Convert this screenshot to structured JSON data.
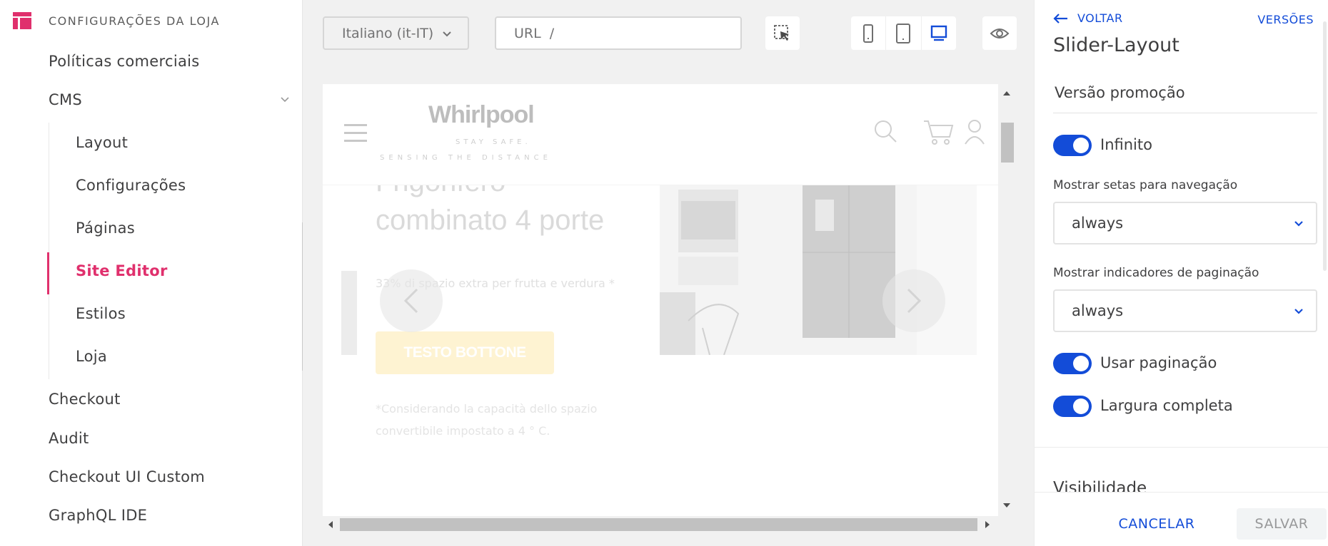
{
  "sidebar": {
    "title": "CONFIGURAÇÕES DA LOJA",
    "items": [
      {
        "label": "Políticas comerciais"
      },
      {
        "label": "CMS"
      },
      {
        "label": "Checkout"
      },
      {
        "label": "Audit"
      },
      {
        "label": "Checkout UI Custom"
      },
      {
        "label": "GraphQL IDE"
      }
    ],
    "cms_subitems": [
      {
        "label": "Layout"
      },
      {
        "label": "Configurações"
      },
      {
        "label": "Páginas"
      },
      {
        "label": "Site Editor",
        "active": true
      },
      {
        "label": "Estilos"
      },
      {
        "label": "Loja"
      }
    ]
  },
  "toolbar": {
    "language": "Italiano (it-IT)",
    "url_label": "URL",
    "url_path": "/",
    "devices": [
      "mobile-icon",
      "tablet-icon",
      "desktop-icon"
    ],
    "active_device": "desktop-icon"
  },
  "preview": {
    "brand": "Whirlpool",
    "tagline_1": "STAY SAFE.",
    "tagline_2": "SENSING THE DISTANCE",
    "hero_title": "Frigorifero combinato 4 porte",
    "hero_description": "33% di spazio extra per frutta e verdura *",
    "cta_label": "TESTO BOTTONE",
    "footnote": "*Considerando la capacità dello spazio convertibile impostato a 4 ° C."
  },
  "panel": {
    "back_label": "VOLTAR",
    "versions_label": "VERSÕES",
    "title": "Slider-Layout",
    "version_name": "Versão promoção",
    "infinite_label": "Infinito",
    "infinite_on": true,
    "arrows_label": "Mostrar setas para navegação",
    "arrows_value": "always",
    "dots_label": "Mostrar indicadores de paginação",
    "dots_value": "always",
    "use_pagination_label": "Usar paginação",
    "use_pagination_on": true,
    "full_width_label": "Largura completa",
    "full_width_on": true,
    "next_section_label": "Visibilidade",
    "cancel_label": "CANCELAR",
    "save_label": "SALVAR"
  },
  "colors": {
    "accent": "#134cd8",
    "brand_pink": "#e0306d"
  }
}
